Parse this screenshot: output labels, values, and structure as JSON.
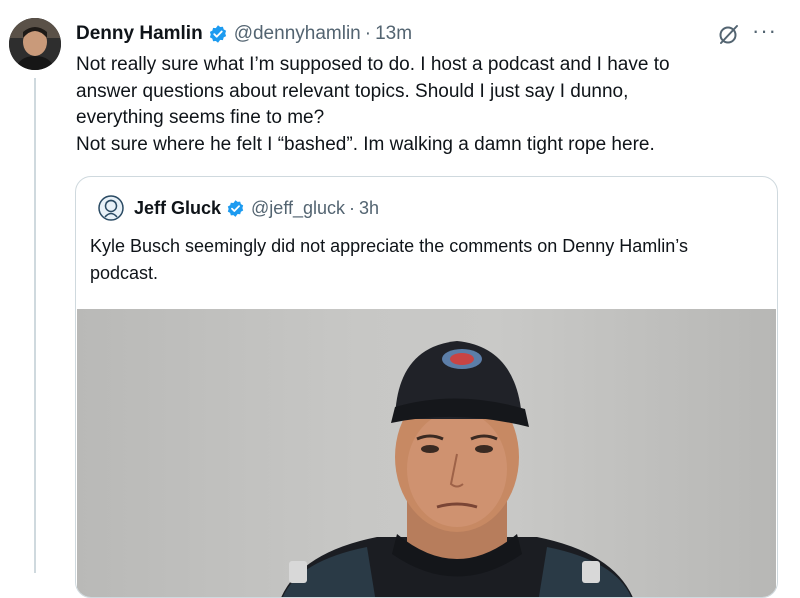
{
  "tweet": {
    "author_name": "Denny Hamlin",
    "author_handle": "@dennyhamlin",
    "separator": "·",
    "time": "13m",
    "text": "Not really sure what I’m supposed to do. I host a podcast and I have to\nanswer questions about relevant topics.  Should I just say I dunno,\neverything seems fine to me?\nNot sure where he felt I “bashed”. Im walking a damn tight rope here."
  },
  "quote": {
    "author_name": "Jeff Gluck",
    "author_handle": "@jeff_gluck",
    "separator": "·",
    "time": "3h",
    "text": "Kyle Busch seemingly did not appreciate the comments on Denny Hamlin’s podcast."
  },
  "icons": {
    "verified": "verified-badge-icon",
    "grok": "grok-icon",
    "more": "more-options-icon"
  },
  "colors": {
    "verified_blue": "#1d9bf0",
    "secondary_text": "#536471",
    "border": "#cfd9de"
  }
}
